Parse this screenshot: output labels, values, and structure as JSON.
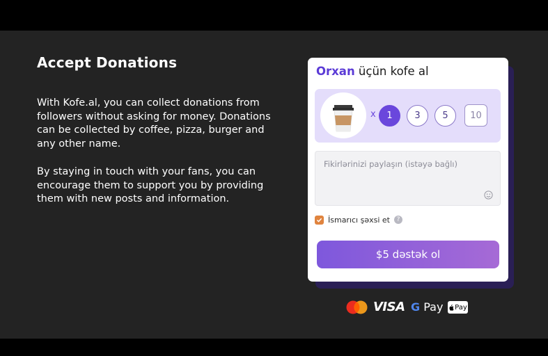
{
  "hero": {
    "heading": "Accept Donations",
    "paragraph1": "With Kofe.al, you can collect donations from followers without asking for money. Donations can be collected by coffee, pizza, burger and any other name.",
    "paragraph2": "By staying in touch with your fans, you can encourage them to support you by providing them with new posts and information."
  },
  "widget": {
    "creator_name": "Orxan",
    "title_rest": " üçün kofe al",
    "item_icon": "coffee-cup-icon",
    "multiplier": "x",
    "amounts": [
      "1",
      "3",
      "5"
    ],
    "selected_amount": "1",
    "custom_amount": "10",
    "comment_placeholder": "Fikirlərinizi paylaşın (istəyə bağlı)",
    "private_label": "İsmarıcı şəxsi et",
    "private_checked": true,
    "help_symbol": "?",
    "support_button": "$5 dəstək ol",
    "accent_color": "#6a47dc",
    "button_gradient": [
      "#7e58dc",
      "#a66ad6"
    ]
  },
  "payments": {
    "methods": [
      "mastercard-icon",
      "visa-icon",
      "google-pay-icon",
      "apple-pay-icon"
    ],
    "visa_text": "VISA",
    "gpay_g": "G",
    "gpay_text": "Pay",
    "apay_text": "Pay"
  }
}
